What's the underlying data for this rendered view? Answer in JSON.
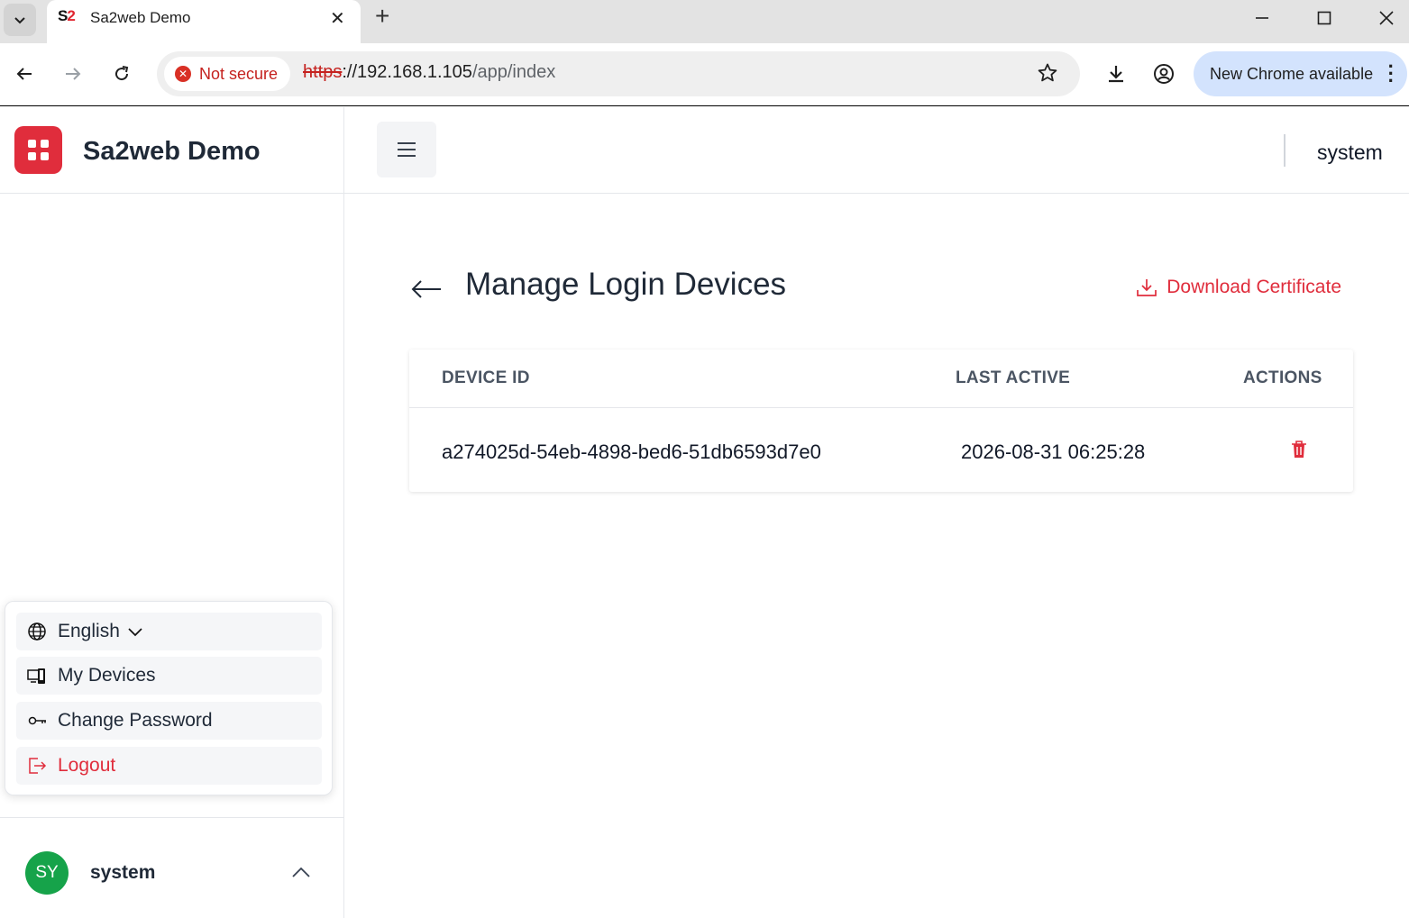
{
  "browser": {
    "tab_title": "Sa2web Demo",
    "favicon_text_a": "S",
    "favicon_text_b": "2",
    "security_label": "Not secure",
    "url_scheme": "https",
    "url_rest": "://192.168.1.105",
    "url_path": "/app/index",
    "update_label": "New Chrome available"
  },
  "app": {
    "brand_name": "Sa2web Demo",
    "topbar_user": "system"
  },
  "page": {
    "title": "Manage Login Devices",
    "download_label": "Download Certificate"
  },
  "table": {
    "headers": [
      "DEVICE ID",
      "LAST ACTIVE",
      "ACTIONS"
    ],
    "rows": [
      {
        "device_id": "a274025d-54eb-4898-bed6-51db6593d7e0",
        "last_active": "2026-08-31 06:25:28"
      }
    ]
  },
  "user_menu": {
    "items": [
      {
        "label": "English",
        "icon": "globe-icon"
      },
      {
        "label": "My Devices",
        "icon": "devices-icon"
      },
      {
        "label": "Change Password",
        "icon": "key-icon"
      },
      {
        "label": "Logout",
        "icon": "logout-icon"
      }
    ]
  },
  "user_bar": {
    "initials": "SY",
    "name": "system"
  },
  "colors": {
    "accent": "#e02d3c",
    "avatar": "#16a34a",
    "update_pill": "#d3e3fd"
  }
}
